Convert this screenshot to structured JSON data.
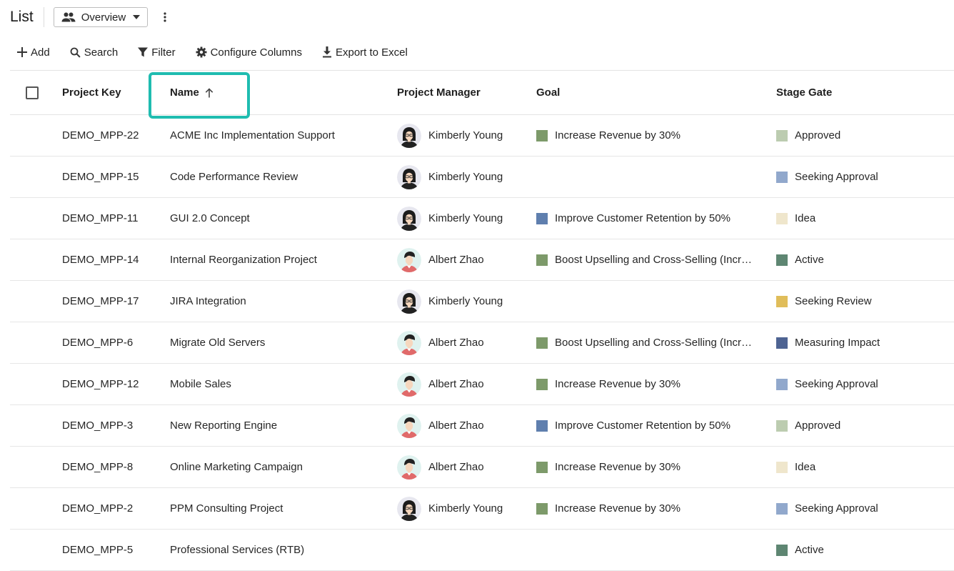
{
  "header": {
    "title": "List",
    "view_label": "Overview",
    "view_icon": "people-icon",
    "more_icon": "more-vert-icon"
  },
  "toolbar": {
    "add": "Add",
    "search": "Search",
    "filter": "Filter",
    "configure": "Configure Columns",
    "export": "Export to Excel"
  },
  "columns": {
    "key": "Project Key",
    "name": "Name",
    "pm": "Project Manager",
    "goal": "Goal",
    "stage": "Stage Gate"
  },
  "sort": {
    "column": "Name",
    "direction": "ascending"
  },
  "colors": {
    "highlight": "#1fbcb0",
    "goal_revenue": "#7d9a6a",
    "goal_retention": "#5f7fae",
    "goal_upsell": "#7d9a6a",
    "stage_approved": "#bcccb0",
    "stage_seeking_approval": "#91a8cc",
    "stage_idea": "#efe6cc",
    "stage_active": "#5e8672",
    "stage_seeking_review": "#e0bd5a",
    "stage_measuring_impact": "#4e6392"
  },
  "rows": [
    {
      "key": "DEMO_MPP-22",
      "name": "ACME Inc Implementation Support",
      "pm": "Kimberly Young",
      "avatar": "kimberly",
      "goal": "Increase Revenue by 30%",
      "goal_color": "#7d9a6a",
      "stage": "Approved",
      "stage_color": "#bcccb0"
    },
    {
      "key": "DEMO_MPP-15",
      "name": "Code Performance Review",
      "pm": "Kimberly Young",
      "avatar": "kimberly",
      "goal": "",
      "goal_color": "",
      "stage": "Seeking Approval",
      "stage_color": "#91a8cc"
    },
    {
      "key": "DEMO_MPP-11",
      "name": "GUI 2.0 Concept",
      "pm": "Kimberly Young",
      "avatar": "kimberly",
      "goal": "Improve Customer Retention by 50%",
      "goal_color": "#5f7fae",
      "stage": "Idea",
      "stage_color": "#efe6cc"
    },
    {
      "key": "DEMO_MPP-14",
      "name": "Internal Reorganization Project",
      "pm": "Albert Zhao",
      "avatar": "albert",
      "goal": "Boost Upselling and Cross-Selling (Incr…",
      "goal_color": "#7d9a6a",
      "stage": "Active",
      "stage_color": "#5e8672"
    },
    {
      "key": "DEMO_MPP-17",
      "name": "JIRA Integration",
      "pm": "Kimberly Young",
      "avatar": "kimberly",
      "goal": "",
      "goal_color": "",
      "stage": "Seeking Review",
      "stage_color": "#e0bd5a"
    },
    {
      "key": "DEMO_MPP-6",
      "name": "Migrate Old Servers",
      "pm": "Albert Zhao",
      "avatar": "albert",
      "goal": "Boost Upselling and Cross-Selling (Incr…",
      "goal_color": "#7d9a6a",
      "stage": "Measuring Impact",
      "stage_color": "#4e6392"
    },
    {
      "key": "DEMO_MPP-12",
      "name": "Mobile Sales",
      "pm": "Albert Zhao",
      "avatar": "albert",
      "goal": "Increase Revenue by 30%",
      "goal_color": "#7d9a6a",
      "stage": "Seeking Approval",
      "stage_color": "#91a8cc"
    },
    {
      "key": "DEMO_MPP-3",
      "name": "New Reporting Engine",
      "pm": "Albert Zhao",
      "avatar": "albert",
      "goal": "Improve Customer Retention by 50%",
      "goal_color": "#5f7fae",
      "stage": "Approved",
      "stage_color": "#bcccb0"
    },
    {
      "key": "DEMO_MPP-8",
      "name": "Online Marketing Campaign",
      "pm": "Albert Zhao",
      "avatar": "albert",
      "goal": "Increase Revenue by 30%",
      "goal_color": "#7d9a6a",
      "stage": "Idea",
      "stage_color": "#efe6cc"
    },
    {
      "key": "DEMO_MPP-2",
      "name": "PPM Consulting Project",
      "pm": "Kimberly Young",
      "avatar": "kimberly",
      "goal": "Increase Revenue by 30%",
      "goal_color": "#7d9a6a",
      "stage": "Seeking Approval",
      "stage_color": "#91a8cc"
    },
    {
      "key": "DEMO_MPP-5",
      "name": "Professional Services (RTB)",
      "pm": "",
      "avatar": "",
      "goal": "",
      "goal_color": "",
      "stage": "Active",
      "stage_color": "#5e8672"
    }
  ]
}
